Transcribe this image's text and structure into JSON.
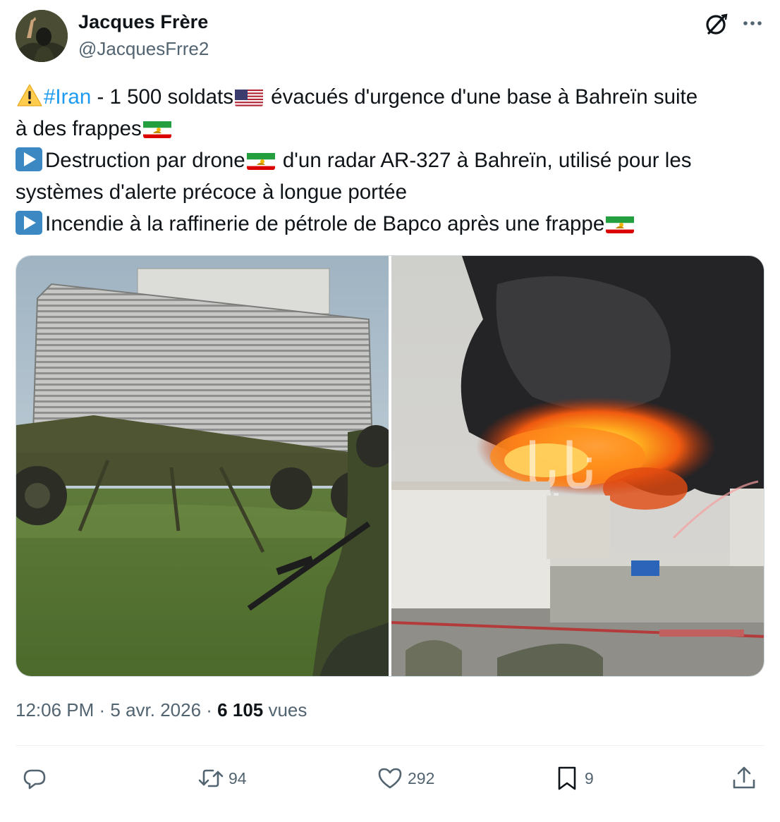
{
  "author": {
    "display_name": "Jacques Frère",
    "handle": "@JacquesFrre2"
  },
  "header_icons": [
    "grok-icon",
    "more-icon"
  ],
  "tweet": {
    "warning_emoji": "⚠️",
    "hashtag": "#Iran",
    "line1_rest": " - 1 500 soldats",
    "line1_after_flag": " évacués d'urgence d'une base à Bahreïn suite",
    "line2_text": "à des frappes",
    "line3_text": "Destruction par drone",
    "line3_after_flag": " d'un radar AR-327 à Bahreïn, utilisé pour les",
    "line4_text": "systèmes d'alerte précoce à longue portée",
    "line5_text": "Incendie à la raffinerie de pétrole de Bapco après une frappe"
  },
  "media": [
    {
      "name": "radar-photo",
      "icon": "photo"
    },
    {
      "name": "refinery-fire-photo",
      "icon": "photo",
      "watermark": "نايا"
    }
  ],
  "meta": {
    "time": "12:06 PM",
    "separator": " · ",
    "date": "5 avr. 2026",
    "views_count": "6 105",
    "views_label": " vues"
  },
  "actions": {
    "replies": "",
    "retweets": "94",
    "likes": "292",
    "bookmarks": "9"
  },
  "colors": {
    "text": "#0f1419",
    "secondary": "#536471",
    "hashtag": "#1d9bf0",
    "divider": "#eff3f4"
  }
}
